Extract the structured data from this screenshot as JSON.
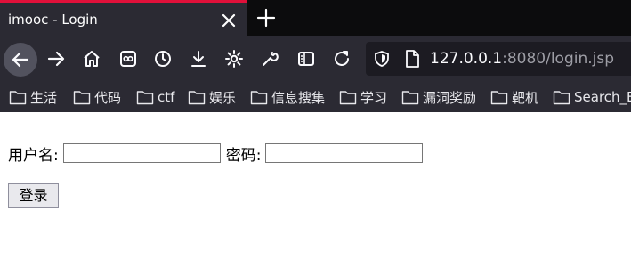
{
  "tab": {
    "title": "imooc - Login"
  },
  "address_bar": {
    "host": "127.0.0.1",
    "rest": ":8080/login.jsp"
  },
  "bookmarks": [
    "生活",
    "代码",
    "ctf",
    "娱乐",
    "信息搜集",
    "学习",
    "漏洞奖励",
    "靶机",
    "Search_E"
  ],
  "form": {
    "username_label": "用户名:",
    "username_value": "",
    "password_label": "密码:",
    "password_value": "",
    "submit_label": "登录"
  },
  "colors": {
    "tab_accent": "#e0103a",
    "toolbar_bg": "#2b2a33",
    "tabstrip_bg": "#0c0c0d"
  },
  "icons": [
    "close-icon",
    "plus-icon",
    "back-icon",
    "forward-icon",
    "home-icon",
    "reader-icon",
    "history-icon",
    "download-icon",
    "settings-gear-icon",
    "wrench-icon",
    "sidebar-icon",
    "reload-icon",
    "shield-icon",
    "page-icon",
    "folder-icon"
  ]
}
